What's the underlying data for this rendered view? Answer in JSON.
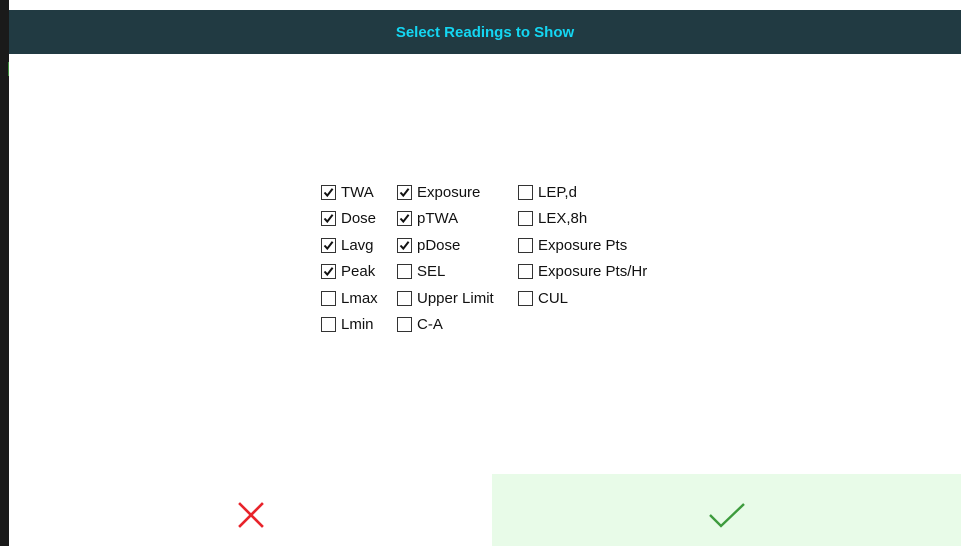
{
  "dialog": {
    "title": "Select Readings to Show"
  },
  "columns": [
    [
      {
        "label": "TWA",
        "checked": true
      },
      {
        "label": "Dose",
        "checked": true
      },
      {
        "label": "Lavg",
        "checked": true
      },
      {
        "label": "Peak",
        "checked": true
      },
      {
        "label": "Lmax",
        "checked": false
      },
      {
        "label": "Lmin",
        "checked": false
      }
    ],
    [
      {
        "label": "Exposure",
        "checked": true
      },
      {
        "label": "pTWA",
        "checked": true
      },
      {
        "label": "pDose",
        "checked": true
      },
      {
        "label": "SEL",
        "checked": false
      },
      {
        "label": "Upper Limit",
        "checked": false
      },
      {
        "label": "C-A",
        "checked": false
      }
    ],
    [
      {
        "label": "LEP,d",
        "checked": false
      },
      {
        "label": "LEX,8h",
        "checked": false
      },
      {
        "label": "Exposure Pts",
        "checked": false
      },
      {
        "label": "Exposure Pts/Hr",
        "checked": false
      },
      {
        "label": "CUL",
        "checked": false
      }
    ]
  ],
  "footer": {
    "cancel_icon": "close-icon",
    "ok_icon": "checkmark-icon",
    "cancel_color": "#e8232a",
    "ok_color": "#3d9b3d",
    "ok_background": "#e8fbe8"
  },
  "colors": {
    "title_bar": "#213a42",
    "title_text": "#14d6f2"
  }
}
